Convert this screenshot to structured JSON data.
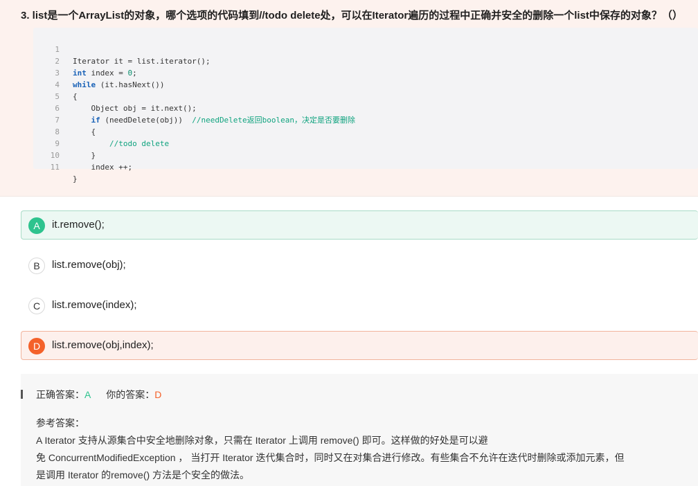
{
  "question": {
    "title": "3. list是一个ArrayList的对象，哪个选项的代码填到//todo delete处，可以在Iterator遍历的过程中正确并安全的删除一个list中保存的对象？（）",
    "code_lines": [
      {
        "n": "1",
        "text": "Iterator it = list.iterator();"
      },
      {
        "n": "2",
        "kw": "int",
        "text": " index = ",
        "num": "0",
        "after": ";"
      },
      {
        "n": "3",
        "kw": "while",
        "text": " (it.hasNext())"
      },
      {
        "n": "4",
        "text": "{"
      },
      {
        "n": "5",
        "text": "    Object obj = it.next();"
      },
      {
        "n": "6",
        "indent": "    ",
        "kw": "if",
        "text": " (needDelete(obj))  ",
        "comment": "//needDelete返回boolean，决定是否要删除"
      },
      {
        "n": "7",
        "text": "    {"
      },
      {
        "n": "8",
        "indent": "        ",
        "comment": "//todo delete"
      },
      {
        "n": "9",
        "text": "    }"
      },
      {
        "n": "10",
        "text": "    index ++;"
      },
      {
        "n": "11",
        "text": "}"
      }
    ]
  },
  "options": [
    {
      "letter": "A",
      "text": "it.remove();",
      "state": "correct"
    },
    {
      "letter": "B",
      "text": "list.remove(obj);",
      "state": "normal"
    },
    {
      "letter": "C",
      "text": "list.remove(index);",
      "state": "normal"
    },
    {
      "letter": "D",
      "text": "list.remove(obj,index);",
      "state": "wrong"
    }
  ],
  "answer": {
    "correct_label": "正确答案：",
    "correct_value": "A",
    "mine_label": "你的答案：",
    "mine_value": "D",
    "reference_title": "参考答案：",
    "reference_lines": [
      "A Iterator  支持从源集合中安全地删除对象，只需在 Iterator 上调用 remove() 即可。这样做的好处是可以避",
      "免 ConcurrentModifiedException ， 当打开 Iterator 迭代集合时，同时又在对集合进行修改。有些集合不允许在迭代时删除或添加元素，但",
      "是调用 Iterator 的remove() 方法是个安全的做法。"
    ]
  },
  "colors": {
    "correct": "#2ec38e",
    "wrong": "#f4612a",
    "question_bg": "#fdf2ee"
  }
}
